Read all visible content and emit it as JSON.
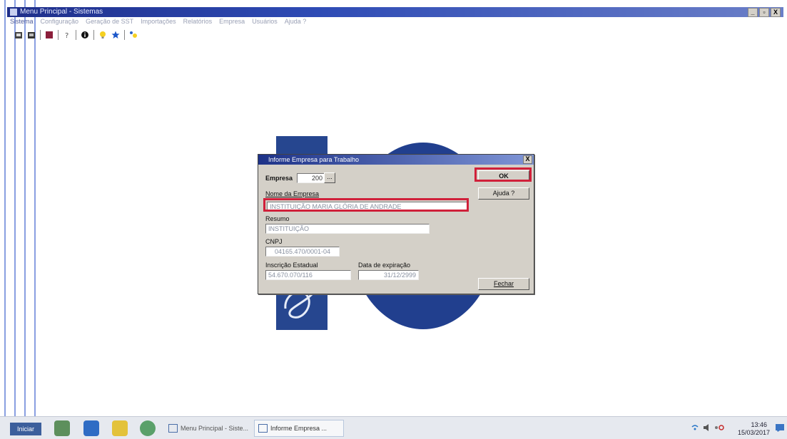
{
  "window": {
    "title": "Menu Principal - Sistemas",
    "buttons": [
      "_",
      "▫",
      "X"
    ]
  },
  "menubar": [
    "Sistema",
    "Configuração",
    "Geração de SST",
    "Importações",
    "Relatórios",
    "Empresa",
    "Usuários",
    "Ajuda ?"
  ],
  "toolbar": {
    "icons": [
      "import-icon",
      "export-icon",
      "book-icon",
      "help-icon",
      "info-icon",
      "bulb-icon",
      "star-icon",
      "tip-icon"
    ]
  },
  "dialog": {
    "title": "Informe Empresa para Trabalho",
    "close": "X",
    "empresa_label": "Empresa",
    "empresa_value": "200",
    "empresa_lookup": "...",
    "nome_label": "Nome da Empresa",
    "nome_value": "INSTITUIÇÃO MARIA GLÓRIA DE ANDRADE",
    "resumo_label": "Resumo",
    "resumo_value": "INSTITUIÇÃO",
    "cnpj_label": "CNPJ",
    "cnpj_value": "04165.470/0001-04",
    "ie_label": "Inscrição Estadual",
    "ie_value": "54.670.070/116",
    "exp_label": "Data de expiração",
    "exp_value": "31/12/2999",
    "ok_label": "OK",
    "ajuda_label": "Ajuda ?",
    "fechar_label": "Fechar"
  },
  "taskbar": {
    "start_label": "Iniciar",
    "items": [
      "Menu Principal - Siste...",
      "Informe Empresa ..."
    ],
    "time": "13:46",
    "date": "15/03/2017"
  },
  "colors": {
    "highlight": "#d0203a",
    "titlebar": "#1f2f8a",
    "logo": "#213f8e"
  }
}
